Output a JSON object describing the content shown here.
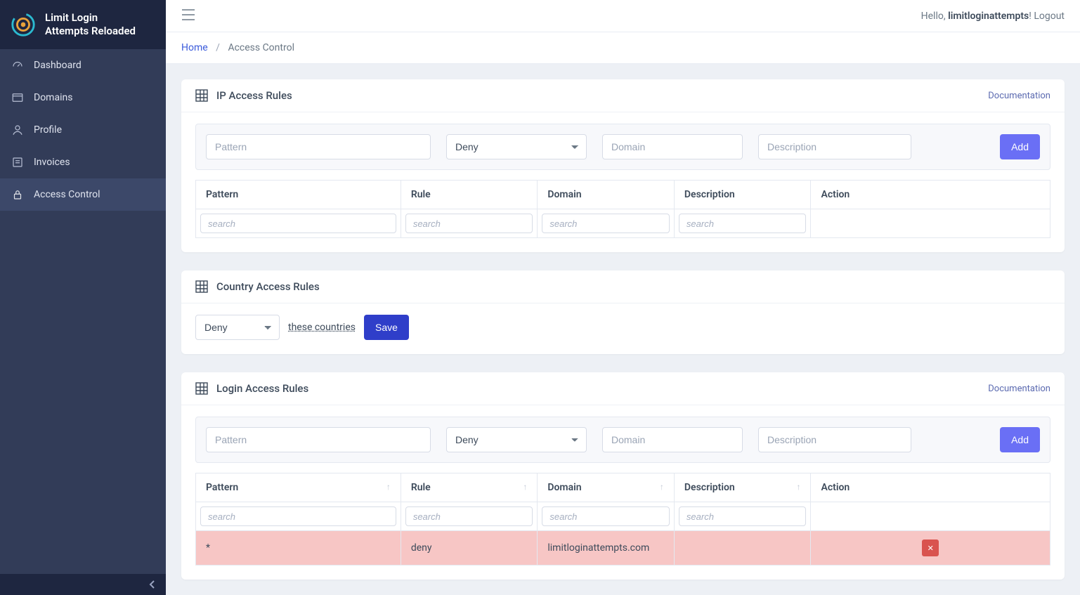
{
  "brand": {
    "line1": "Limit Login",
    "line2": "Attempts Reloaded"
  },
  "sidebar": {
    "items": [
      {
        "label": "Dashboard"
      },
      {
        "label": "Domains"
      },
      {
        "label": "Profile"
      },
      {
        "label": "Invoices"
      },
      {
        "label": "Access Control"
      }
    ]
  },
  "topbar": {
    "greeting_prefix": "Hello, ",
    "username": "limitloginattempts",
    "greeting_suffix": "!",
    "logout": "Logout"
  },
  "breadcrumb": {
    "home": "Home",
    "current": "Access Control"
  },
  "ip_rules": {
    "title": "IP Access Rules",
    "doclink": "Documentation",
    "pattern_ph": "Pattern",
    "rule_selected": "Deny",
    "domain_ph": "Domain",
    "desc_ph": "Description",
    "add_label": "Add",
    "cols": {
      "pattern": "Pattern",
      "rule": "Rule",
      "domain": "Domain",
      "desc": "Description",
      "action": "Action"
    },
    "search_ph": "search"
  },
  "country_rules": {
    "title": "Country Access Rules",
    "rule_selected": "Deny",
    "link": "these countries",
    "save_label": "Save"
  },
  "login_rules": {
    "title": "Login Access Rules",
    "doclink": "Documentation",
    "pattern_ph": "Pattern",
    "rule_selected": "Deny",
    "domain_ph": "Domain",
    "desc_ph": "Description",
    "add_label": "Add",
    "cols": {
      "pattern": "Pattern",
      "rule": "Rule",
      "domain": "Domain",
      "desc": "Description",
      "action": "Action"
    },
    "search_ph": "search",
    "rows": [
      {
        "pattern": "*",
        "rule": "deny",
        "domain": "limitloginattempts.com",
        "desc": ""
      }
    ]
  }
}
